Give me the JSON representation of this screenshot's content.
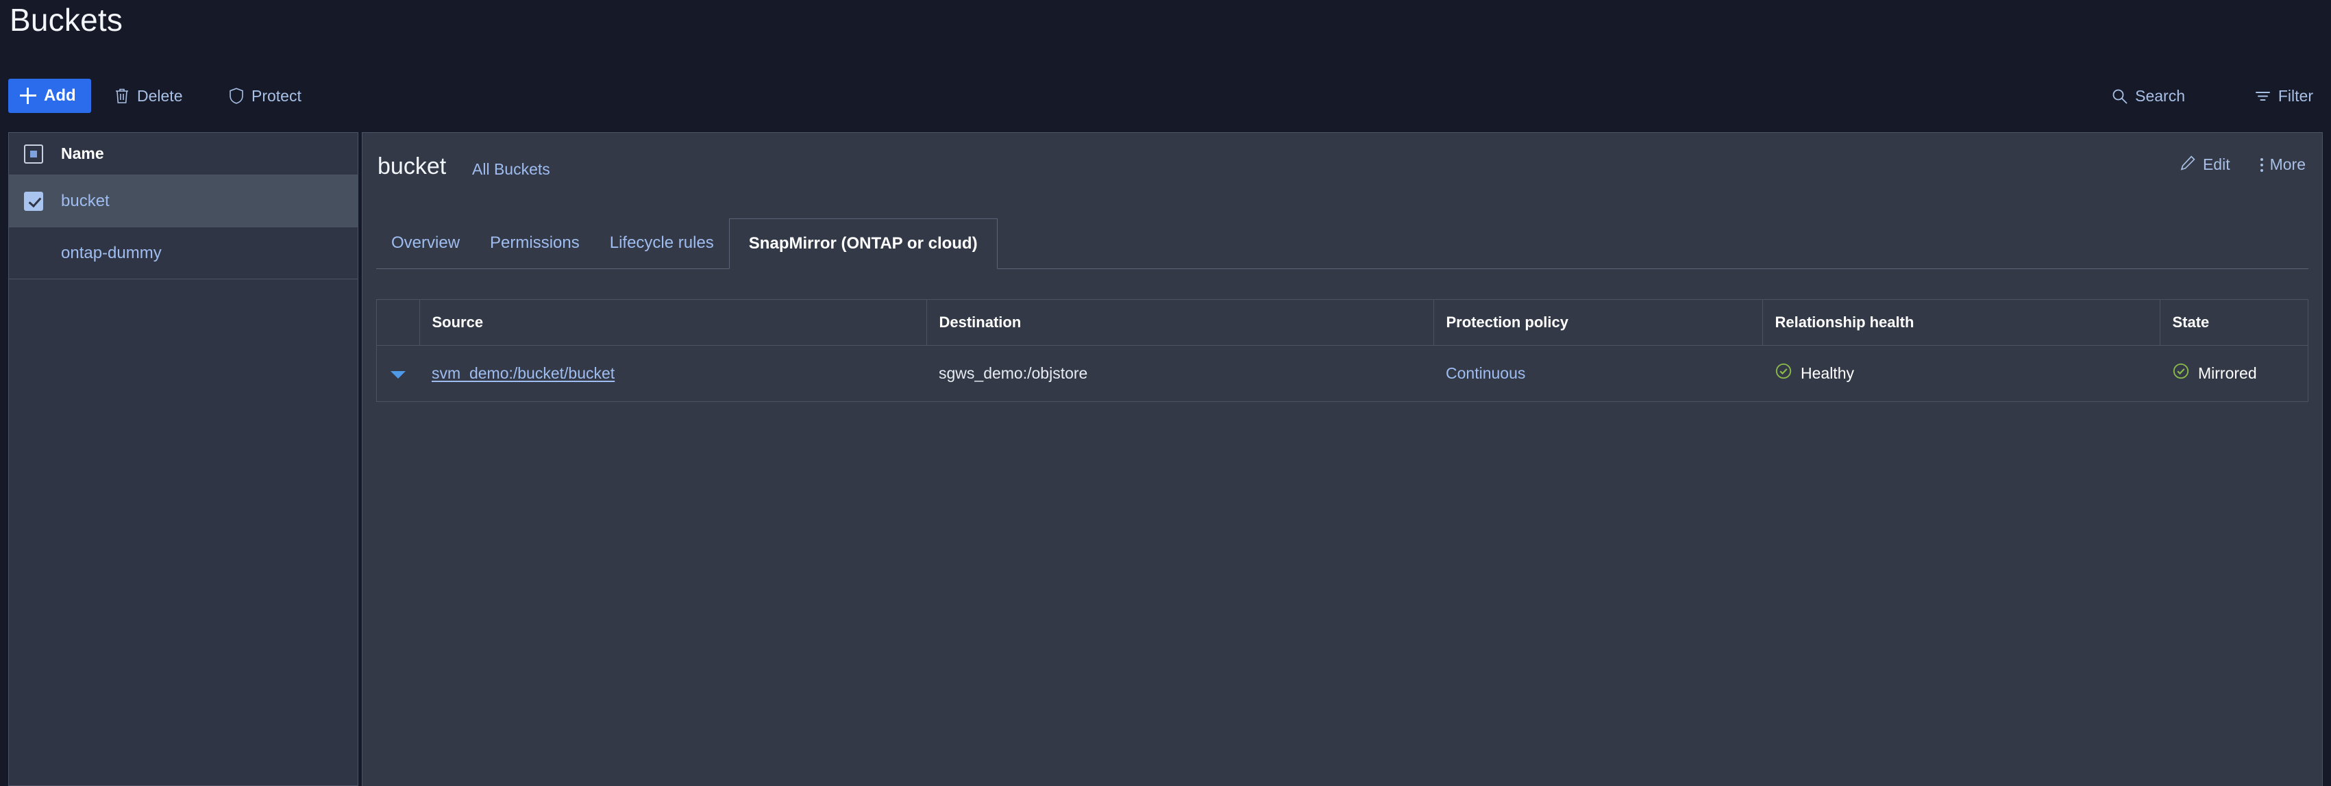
{
  "page": {
    "title": "Buckets"
  },
  "toolbar": {
    "add_label": "Add",
    "delete_label": "Delete",
    "protect_label": "Protect",
    "search_label": "Search",
    "filter_label": "Filter"
  },
  "sidebar": {
    "column_header": "Name",
    "rows": [
      {
        "name": "bucket",
        "selected": true
      },
      {
        "name": "ontap-dummy",
        "selected": false
      }
    ]
  },
  "panel": {
    "bucket_name": "bucket",
    "all_buckets_link": "All Buckets",
    "edit_label": "Edit",
    "more_label": "More",
    "tabs": [
      {
        "label": "Overview",
        "active": false
      },
      {
        "label": "Permissions",
        "active": false
      },
      {
        "label": "Lifecycle rules",
        "active": false
      },
      {
        "label": "SnapMirror (ONTAP or cloud)",
        "active": true
      }
    ]
  },
  "table": {
    "columns": [
      "Source",
      "Destination",
      "Protection policy",
      "Relationship health",
      "State"
    ],
    "rows": [
      {
        "source": "svm_demo:/bucket/bucket",
        "destination": "sgws_demo:/objstore",
        "protection_policy": "Continuous",
        "relationship_health": "Healthy",
        "state": "Mirrored"
      }
    ]
  },
  "colors": {
    "accent_blue": "#2b6ced",
    "link_blue": "#9fbdf0",
    "status_green": "#8ab84a",
    "page_bg": "#161a28",
    "panel_bg": "#333947",
    "sidebar_bg": "#2f3544",
    "row_selected": "#46505f",
    "border": "#4b5365"
  }
}
